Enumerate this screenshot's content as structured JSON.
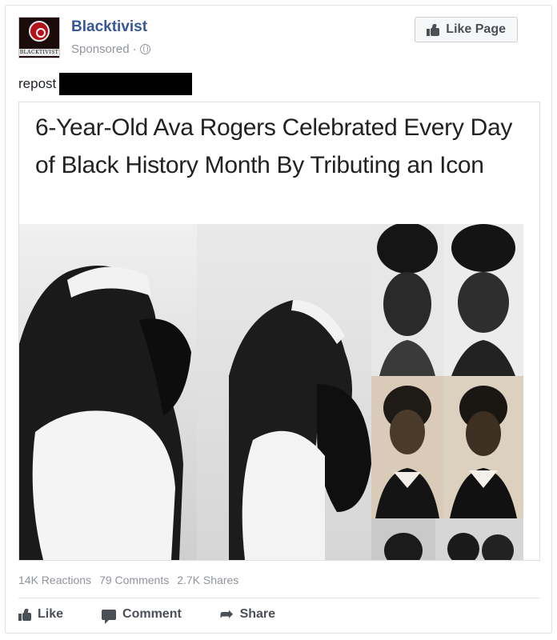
{
  "post": {
    "page_name": "Blacktivist",
    "avatar_tag": "BLACKTIVIST",
    "sponsored": "Sponsored",
    "separator": "·",
    "like_page_label": "Like Page",
    "text": "repost"
  },
  "attachment": {
    "headline": "6-Year-Old Ava Rogers Celebrated Every Day of Black History Month By Tributing an Icon"
  },
  "stats": {
    "reactions": "14K Reactions",
    "comments": "79 Comments",
    "shares": "2.7K Shares"
  },
  "actions": {
    "like": "Like",
    "comment": "Comment",
    "share": "Share"
  },
  "icons": {
    "like": "thumbs-up-icon",
    "comment": "comment-icon",
    "share": "share-arrow-icon",
    "audience": "globe-icon"
  },
  "colors": {
    "link": "#365899",
    "muted": "#90949c",
    "action": "#4b4f56"
  }
}
